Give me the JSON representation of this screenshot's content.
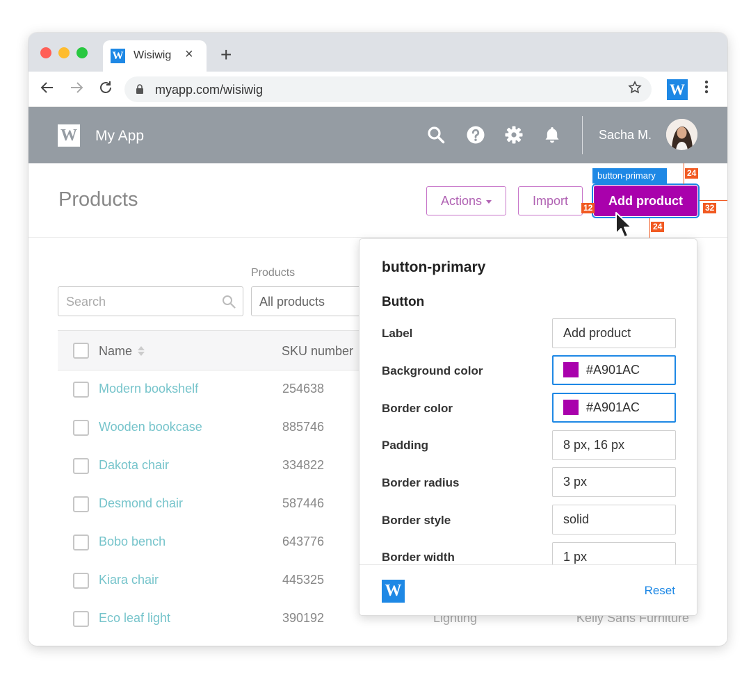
{
  "browser": {
    "tab_title": "Wisiwig",
    "tab_favicon": "W",
    "tab_close": "×",
    "new_tab": "+",
    "url": "myapp.com/wisiwig",
    "extension_letter": "W",
    "icons": [
      "back-arrow-icon",
      "forward-arrow-icon",
      "reload-icon",
      "lock-icon",
      "star-icon",
      "kebab-menu-icon"
    ]
  },
  "app": {
    "logo_letter": "W",
    "name": "My App",
    "header_icons": [
      "search-icon",
      "help-icon",
      "gear-icon",
      "bell-icon"
    ],
    "user_name": "Sacha M.",
    "header_bg": "#959CA3"
  },
  "page": {
    "title": "Products",
    "actions_label": "Actions",
    "import_label": "Import",
    "add_product_label": "Add product"
  },
  "overlay": {
    "tag": "button-primary",
    "measure_top": "24",
    "measure_bottom": "24",
    "measure_left": "12",
    "measure_right": "32"
  },
  "filters": {
    "products_label": "Products",
    "search_placeholder": "Search",
    "products_select": "All products"
  },
  "table": {
    "columns": [
      "Name",
      "SKU number"
    ],
    "rows": [
      {
        "name": "Modern bookshelf",
        "sku": "254638",
        "category": "",
        "vendor": ""
      },
      {
        "name": "Wooden bookcase",
        "sku": "885746",
        "category": "",
        "vendor": ""
      },
      {
        "name": "Dakota chair",
        "sku": "334822",
        "category": "",
        "vendor": ""
      },
      {
        "name": "Desmond chair",
        "sku": "587446",
        "category": "",
        "vendor": ""
      },
      {
        "name": "Bobo bench",
        "sku": "643776",
        "category": "",
        "vendor": ""
      },
      {
        "name": "Kiara chair",
        "sku": "445325",
        "category": "",
        "vendor": ""
      },
      {
        "name": "Eco leaf light",
        "sku": "390192",
        "category": "Lighting",
        "vendor": "Kelly Sans Furniture"
      }
    ]
  },
  "inspector": {
    "title": "button-primary",
    "section": "Button",
    "fields": [
      {
        "label": "Label",
        "value": "Add product"
      },
      {
        "label": "Background color",
        "value": "#A901AC",
        "swatch": "#A901AC"
      },
      {
        "label": "Border color",
        "value": "#A901AC",
        "swatch": "#A901AC"
      },
      {
        "label": "Padding",
        "value": "8 px, 16 px"
      },
      {
        "label": "Border radius",
        "value": "3 px"
      },
      {
        "label": "Border style",
        "value": "solid"
      },
      {
        "label": "Border width",
        "value": "1 px"
      }
    ],
    "footer_logo": "W",
    "reset_label": "Reset"
  },
  "colors": {
    "primary": "#A901AC",
    "outline": "#C775C9",
    "accent_blue": "#1E88E5",
    "measure": "#F15A22",
    "link": "#76C4CB"
  }
}
